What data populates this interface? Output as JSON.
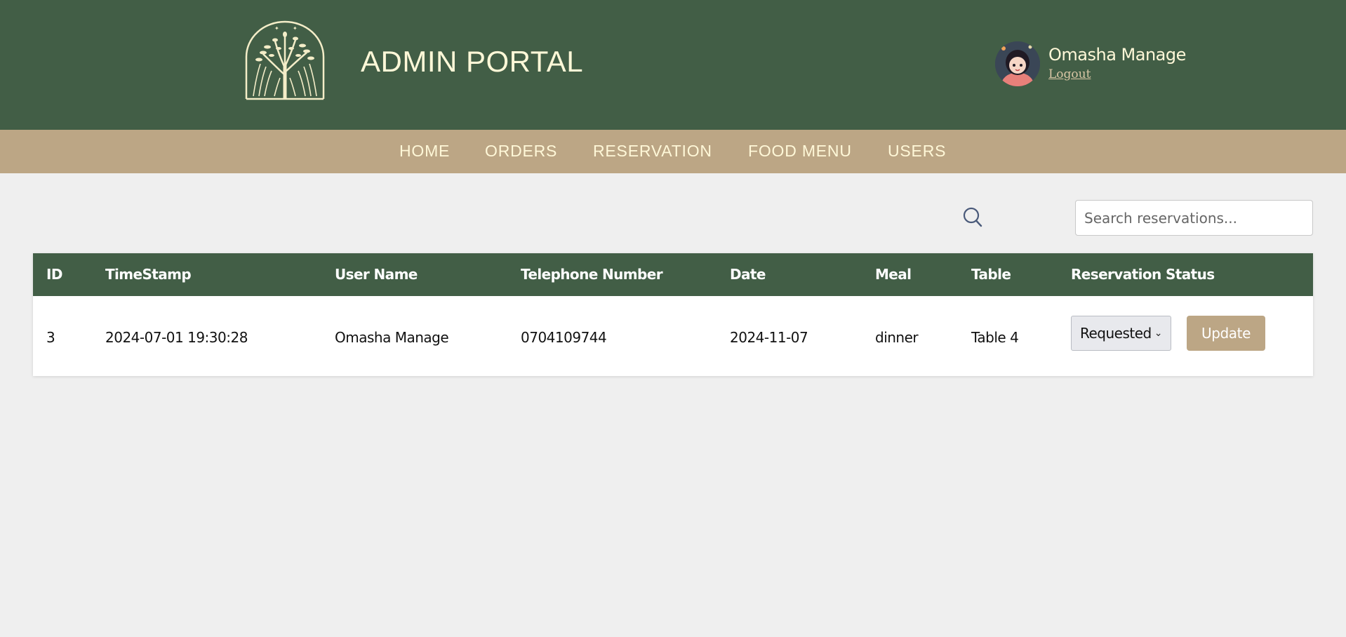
{
  "header": {
    "portal_title": "ADMIN PORTAL",
    "user_name": "Omasha Manage",
    "logout_label": "Logout"
  },
  "nav": {
    "items": [
      {
        "label": "HOME"
      },
      {
        "label": "ORDERS"
      },
      {
        "label": "RESERVATION"
      },
      {
        "label": "FOOD MENU"
      },
      {
        "label": "USERS"
      }
    ]
  },
  "search": {
    "placeholder": "Search reservations...",
    "value": "",
    "icon": "search-icon"
  },
  "table": {
    "columns": [
      "ID",
      "TimeStamp",
      "User Name",
      "Telephone Number",
      "Date",
      "Meal",
      "Table",
      "Reservation Status"
    ],
    "rows": [
      {
        "id": "3",
        "timestamp": "2024-07-01 19:30:28",
        "user_name": "Omasha Manage",
        "telephone": "0704109744",
        "date": "2024-11-07",
        "meal": "dinner",
        "table": "Table 4",
        "status": "Requested",
        "update_label": "Update"
      }
    ]
  },
  "colors": {
    "header_bg": "#425e46",
    "nav_bg": "#bca685",
    "accent_text": "#fff8d8",
    "page_bg": "#efefef"
  }
}
